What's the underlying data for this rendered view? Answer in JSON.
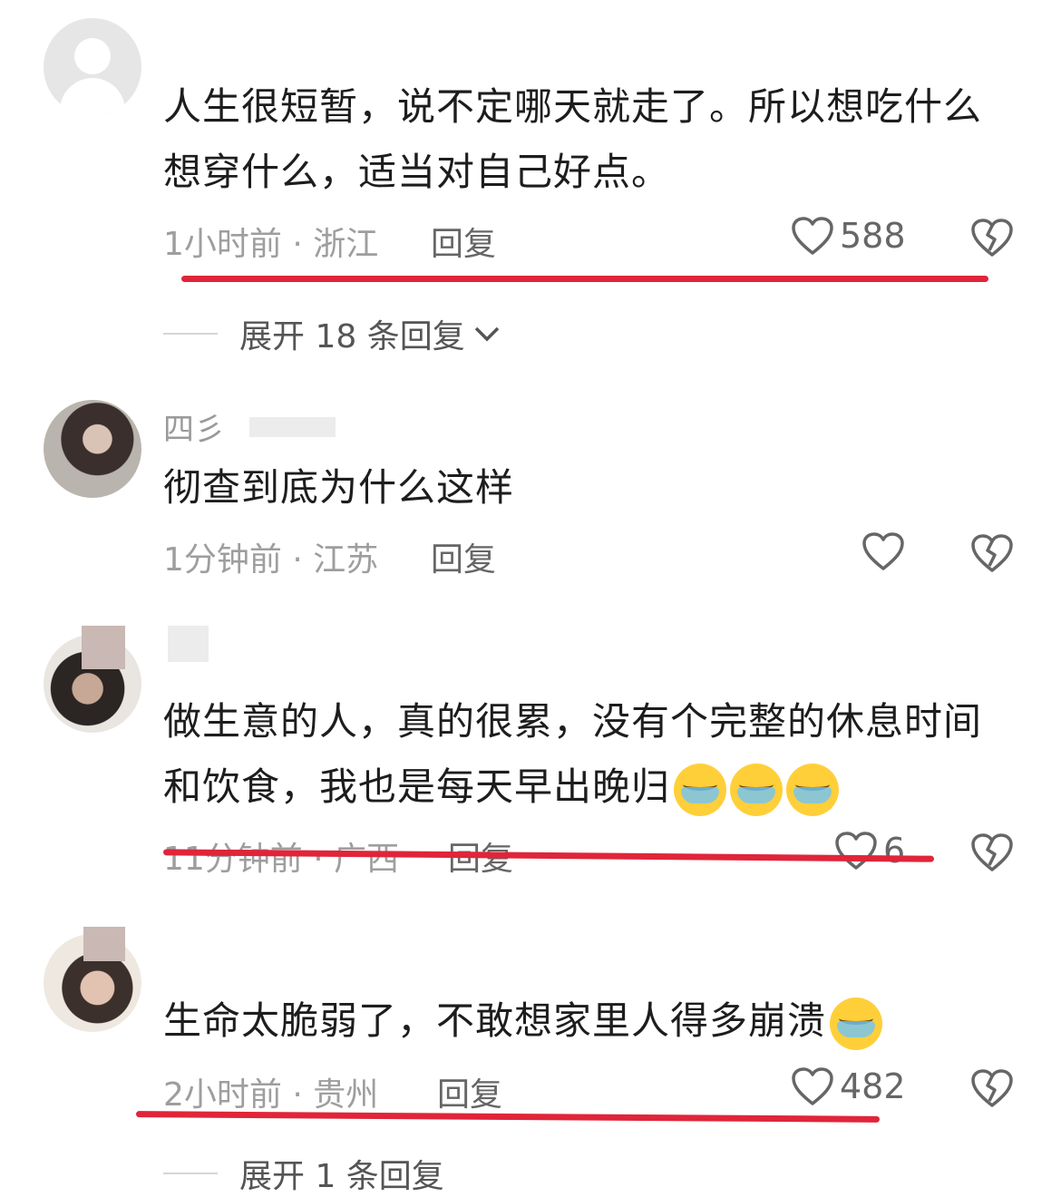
{
  "comments": [
    {
      "username": "",
      "text_lines": [
        "人生很短暂，说不定哪天就走了。所以想吃什么",
        "想穿什么，适当对自己好点。"
      ],
      "time_location": "1小时前 · 浙江",
      "reply_label": "回复",
      "likes": "588",
      "expand_label": "展开 18 条回复"
    },
    {
      "username": "四彡",
      "text_lines": [
        "彻查到底为什么这样"
      ],
      "time_location": "1分钟前 · 江苏",
      "reply_label": "回复",
      "likes": ""
    },
    {
      "username": "",
      "text_lines": [
        "做生意的人，真的很累，没有个完整的休息时间",
        "和饮食，我也是每天早出晚归"
      ],
      "time_location": "11分钟前 · 广西",
      "reply_label": "回复",
      "likes": "6"
    },
    {
      "username": "",
      "text_lines": [
        "生命太脆弱了，不敢想家里人得多崩溃"
      ],
      "time_location": "2小时前 · 贵州",
      "reply_label": "回复",
      "likes": "482",
      "expand_label": "展开 1 条回复"
    }
  ],
  "icons": {
    "like": "heart-outline-icon",
    "dislike": "broken-heart-icon",
    "expand": "chevron-down-icon",
    "emoji": "loudly-crying-face-icon"
  },
  "colors": {
    "annotation_underline": "#e0253a",
    "meta_text": "#9e9e9e"
  }
}
